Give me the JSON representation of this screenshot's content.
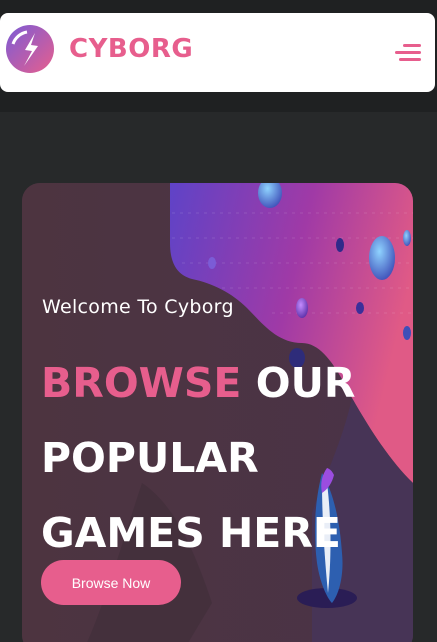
{
  "header": {
    "brand": "CYBORG",
    "menu_icon": "hamburger-menu-icon",
    "logo_icon": "cyborg-logo-icon"
  },
  "banner": {
    "welcome": "Welcome To Cyborg",
    "headline_accent": "BROWSE",
    "headline_line1_rest": " OUR",
    "headline_line2": "POPULAR",
    "headline_line3": "GAMES HERE",
    "cta_label": "Browse Now"
  },
  "colors": {
    "accent": "#e75e8d",
    "page_bg": "#27292a",
    "header_bg": "#ffffff",
    "text": "#ffffff"
  }
}
